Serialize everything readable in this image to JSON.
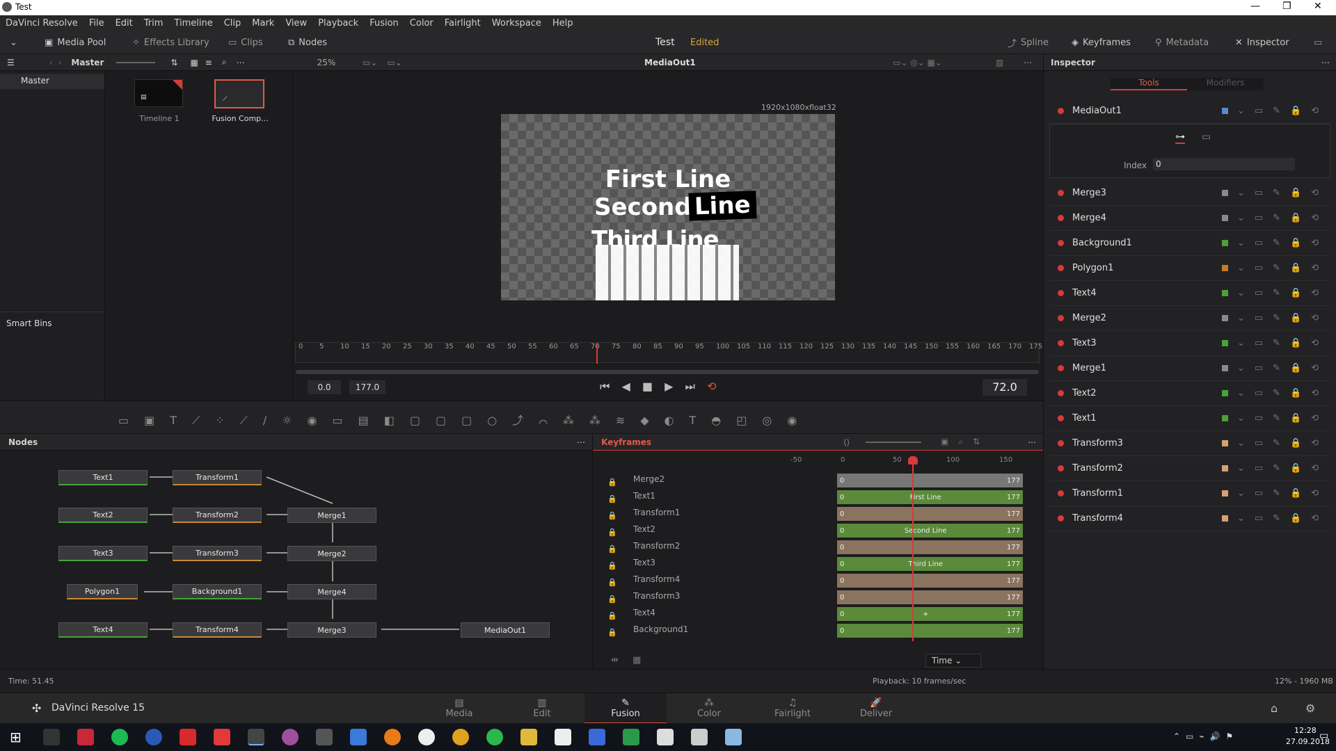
{
  "window": {
    "title": "Test"
  },
  "menu": [
    "DaVinci Resolve",
    "File",
    "Edit",
    "Trim",
    "Timeline",
    "Clip",
    "Mark",
    "View",
    "Playback",
    "Fusion",
    "Color",
    "Fairlight",
    "Workspace",
    "Help"
  ],
  "toolbar": {
    "media_pool": "Media Pool",
    "effects_library": "Effects Library",
    "clips": "Clips",
    "nodes": "Nodes",
    "project": "Test",
    "status": "Edited",
    "spline": "Spline",
    "keyframes": "Keyframes",
    "metadata": "Metadata",
    "inspector": "Inspector"
  },
  "media_pool": {
    "bin": "Master",
    "zoom": "25%",
    "bins": [
      "Master"
    ],
    "smart_bins": "Smart Bins",
    "clips": [
      {
        "label": "Timeline 1"
      },
      {
        "label": "Fusion Comp..."
      }
    ]
  },
  "viewer": {
    "name": "MediaOut1",
    "resolution": "1920x1080xfloat32",
    "lines": [
      "First Line",
      "Second",
      "Line",
      "Third Line"
    ],
    "ruler_ticks": [
      "0",
      "5",
      "10",
      "15",
      "20",
      "25",
      "30",
      "35",
      "40",
      "45",
      "50",
      "55",
      "60",
      "65",
      "70",
      "75",
      "80",
      "85",
      "90",
      "95",
      "100",
      "105",
      "110",
      "115",
      "120",
      "125",
      "130",
      "135",
      "140",
      "145",
      "150",
      "155",
      "160",
      "165",
      "170",
      "175"
    ],
    "start": "0.0",
    "end": "177.0",
    "current": "72.0"
  },
  "inspector": {
    "title": "Inspector",
    "tabs": [
      "Tools",
      "Modifiers"
    ],
    "selected_tool": "MediaOut1",
    "index_label": "Index",
    "index_value": "0",
    "tools": [
      {
        "name": "Merge3",
        "color": "#8a8a8a"
      },
      {
        "name": "Merge4",
        "color": "#8a8a8a"
      },
      {
        "name": "Background1",
        "color": "#4aa23a"
      },
      {
        "name": "Polygon1",
        "color": "#c87a28"
      },
      {
        "name": "Text4",
        "color": "#4aa23a"
      },
      {
        "name": "Merge2",
        "color": "#8a8a8a"
      },
      {
        "name": "Text3",
        "color": "#4aa23a"
      },
      {
        "name": "Merge1",
        "color": "#8a8a8a"
      },
      {
        "name": "Text2",
        "color": "#4aa23a"
      },
      {
        "name": "Text1",
        "color": "#4aa23a"
      },
      {
        "name": "Transform3",
        "color": "#d8a070"
      },
      {
        "name": "Transform2",
        "color": "#d8a070"
      },
      {
        "name": "Transform1",
        "color": "#d8a070"
      },
      {
        "name": "Transform4",
        "color": "#d8a070"
      }
    ]
  },
  "nodes": {
    "title": "Nodes",
    "items": [
      "Text1",
      "Transform1",
      "Text2",
      "Transform2",
      "Merge1",
      "Text3",
      "Transform3",
      "Merge2",
      "Polygon1",
      "Background1",
      "Merge4",
      "Text4",
      "Transform4",
      "Merge3",
      "MediaOut1"
    ]
  },
  "keyframes": {
    "title": "Keyframes",
    "ruler": [
      "-50",
      "0",
      "50",
      "100",
      "150"
    ],
    "rows": [
      {
        "name": "Merge2",
        "start": "0",
        "end": "177",
        "label": ""
      },
      {
        "name": "Text1",
        "start": "0",
        "end": "177",
        "label": "First Line"
      },
      {
        "name": "Transform1",
        "start": "0",
        "end": "177",
        "label": ""
      },
      {
        "name": "Text2",
        "start": "0",
        "end": "177",
        "label": "Second Line"
      },
      {
        "name": "Transform2",
        "start": "0",
        "end": "177",
        "label": ""
      },
      {
        "name": "Text3",
        "start": "0",
        "end": "177",
        "label": "Third Line"
      },
      {
        "name": "Transform4",
        "start": "0",
        "end": "177",
        "label": ""
      },
      {
        "name": "Transform3",
        "start": "0",
        "end": "177",
        "label": ""
      },
      {
        "name": "Text4",
        "start": "0",
        "end": "177",
        "label": "+"
      },
      {
        "name": "Background1",
        "start": "0",
        "end": "177",
        "label": ""
      }
    ],
    "time_mode": "Time"
  },
  "status": {
    "time": "Time: 51.45",
    "playback": "Playback: 10 frames/sec",
    "memory": "12% - 1960 MB"
  },
  "pages": {
    "app": "DaVinci Resolve 15",
    "items": [
      "Media",
      "Edit",
      "Fusion",
      "Color",
      "Fairlight",
      "Deliver"
    ]
  },
  "taskbar": {
    "time": "12:28",
    "date": "27.09.2018"
  }
}
